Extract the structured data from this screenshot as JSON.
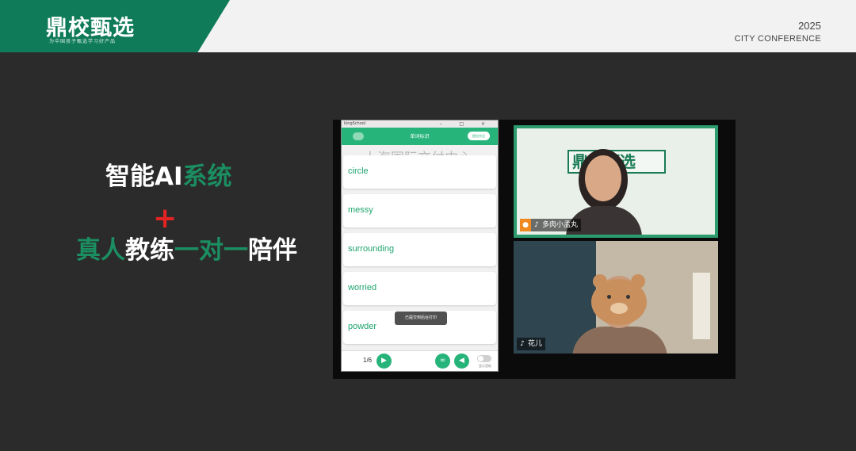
{
  "header": {
    "brand": "鼎校甄选",
    "brand_sub": "为中国孩子甄选学习好产品",
    "year": "2025",
    "event": "CITY CONFERENCE"
  },
  "slide": {
    "claim_line1_white": "智能AI",
    "claim_line1_green": "系统",
    "plus": "+",
    "claim_line2_a": "真人",
    "claim_line2_b": "教练",
    "claim_line2_c": "一对一",
    "claim_line2_d": "陪伴"
  },
  "app": {
    "window_title": "kingSchool",
    "window_controls": "– □ ×",
    "header_title": "单词标识",
    "header_button": "提交作业",
    "watermark": "上海国际交付中心",
    "words": [
      "circle",
      "messy",
      "surrounding",
      "worried",
      "powder"
    ],
    "toast": "已提交到后台打印",
    "pager": "1/6",
    "toggle_label": "显示音标"
  },
  "video": {
    "top_name": "多肉小孟丸",
    "wall_logo": "鼎校甄选",
    "bottom_name": "花儿"
  },
  "colors": {
    "brand_green": "#0f7b58",
    "accent_green": "#1b8e62",
    "plus_red": "#e02424",
    "app_green": "#27b47a"
  }
}
